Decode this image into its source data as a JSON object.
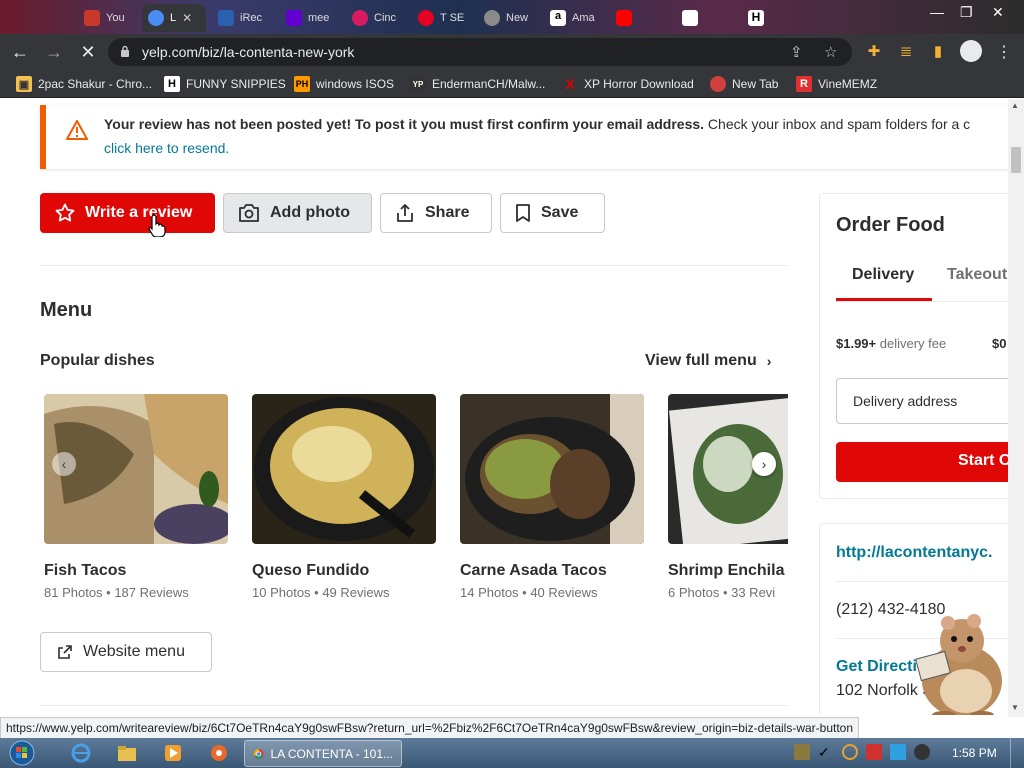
{
  "browser": {
    "tabs": [
      {
        "title": "You",
        "color": "#c7392a"
      },
      {
        "title": "L",
        "color": "#4b8bf4",
        "active": true
      },
      {
        "title": "iRec",
        "color": "#2b5fb0"
      },
      {
        "title": "mee",
        "color": "#6001d2"
      },
      {
        "title": "Cinc",
        "color": "#d81b60"
      },
      {
        "title": "T SE",
        "color": "#e60023"
      },
      {
        "title": "New",
        "color": "#8a8a8a"
      },
      {
        "title": "Ama",
        "color": "#ff9900"
      },
      {
        "title": "",
        "color": "#ff0000"
      },
      {
        "title": "",
        "color": "#ffffff"
      },
      {
        "title": "",
        "color": "#ffffff"
      }
    ],
    "url": "yelp.com/biz/la-contenta-new-york",
    "bookmarks": [
      {
        "label": "2pac Shakur - Chro...",
        "icon": "H",
        "color": "#f0c050"
      },
      {
        "label": "FUNNY SNIPPIES",
        "icon": "H",
        "color": "#ffffff"
      },
      {
        "label": "windows ISOS",
        "icon": "PH",
        "color": "#ff9900"
      },
      {
        "label": "EndermanCH/Malw...",
        "icon": "YP",
        "color": "#333333"
      },
      {
        "label": "XP Horror Download",
        "icon": "X",
        "color": "#e00000"
      },
      {
        "label": "New Tab",
        "icon": "●",
        "color": "#d04040"
      },
      {
        "label": "VineMEMZ",
        "icon": "R",
        "color": "#e03030"
      }
    ]
  },
  "alert": {
    "bold": "Your review has not been posted yet! To post it you must first confirm your email address.",
    "rest": " Check your inbox and spam folders for a c",
    "link": "click here to resend."
  },
  "actions": {
    "write_review": "Write a review",
    "add_photo": "Add photo",
    "share": "Share",
    "save": "Save"
  },
  "menu": {
    "heading": "Menu",
    "popular": "Popular dishes",
    "view_full": "View full menu",
    "website_menu": "Website menu",
    "dishes": [
      {
        "name": "Fish Tacos",
        "photos": "81 Photos",
        "reviews": "187 Reviews",
        "colors": [
          "#c9a46a",
          "#6b5a3a",
          "#e8d9c0"
        ]
      },
      {
        "name": "Queso Fundido",
        "photos": "10 Photos",
        "reviews": "49 Reviews",
        "colors": [
          "#cfb25a",
          "#3a3020",
          "#eadb9a"
        ]
      },
      {
        "name": "Carne Asada Tacos",
        "photos": "14 Photos",
        "reviews": "40 Reviews",
        "colors": [
          "#4a4030",
          "#8a9a40",
          "#2a2418"
        ]
      },
      {
        "name": "Shrimp Enchila",
        "photos": "6 Photos",
        "reviews": "33 Revi",
        "colors": [
          "#e8e6e2",
          "#4a6a3a",
          "#2a2a2a"
        ]
      }
    ]
  },
  "order": {
    "title": "Order Food",
    "tab_delivery": "Delivery",
    "tab_takeout": "Takeout",
    "fee_amount": "$1.99+",
    "fee_label": " delivery fee",
    "fee_extra": "$0",
    "address_placeholder": "Delivery address",
    "start": "Start O"
  },
  "info": {
    "website": "http://lacontentanyc.",
    "phone": "(212) 432-4180",
    "directions": "Get Directio",
    "street": "102 Norfolk St"
  },
  "status_url": "https://www.yelp.com/writeareview/biz/6Ct7OeTRn4caY9g0swFBsw?return_url=%2Fbiz%2F6Ct7OeTRn4caY9g0swFBsw&review_origin=biz-details-war-button",
  "taskbar": {
    "task_label": "LA CONTENTA - 101...",
    "time": "1:58 PM"
  },
  "colors": {
    "yelp_red": "#e00707",
    "link_teal": "#027a97",
    "alert_orange": "#f15c00"
  }
}
